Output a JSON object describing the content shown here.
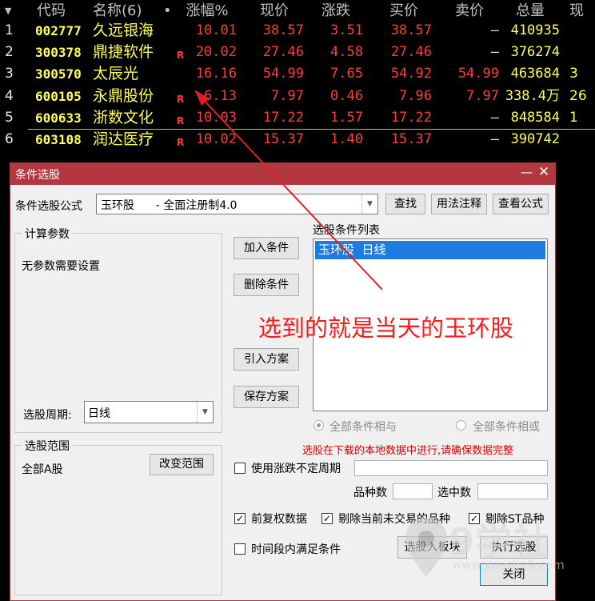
{
  "table": {
    "headers": {
      "sort": "▼",
      "code": "代码",
      "name": "名称(6)",
      "dot": "•",
      "pct": "涨幅%",
      "price": "现价",
      "chg": "涨跌",
      "bid": "买价",
      "ask": "卖价",
      "vol": "总量",
      "extra": "现"
    },
    "rows": [
      {
        "idx": "1",
        "code": "002777",
        "name": "久远银海",
        "r": "",
        "pct": "10.01",
        "price": "38.57",
        "chg": "3.51",
        "bid": "38.57",
        "ask": "—",
        "vol": "410935",
        "extra": ""
      },
      {
        "idx": "2",
        "code": "300378",
        "name": "鼎捷软件",
        "r": "R",
        "pct": "20.02",
        "price": "27.46",
        "chg": "4.58",
        "bid": "27.46",
        "ask": "—",
        "vol": "376274",
        "extra": ""
      },
      {
        "idx": "3",
        "code": "300570",
        "name": "太辰光",
        "r": "",
        "pct": "16.16",
        "price": "54.99",
        "chg": "7.65",
        "bid": "54.92",
        "ask": "54.99",
        "vol": "463684",
        "extra": "3"
      },
      {
        "idx": "4",
        "code": "600105",
        "name": "永鼎股份",
        "r": "R",
        "pct": "6.13",
        "price": "7.97",
        "chg": "0.46",
        "bid": "7.96",
        "ask": "7.97",
        "vol": "338.4万",
        "extra": "26"
      },
      {
        "idx": "5",
        "code": "600633",
        "name": "浙数文化",
        "r": "R",
        "pct": "10.03",
        "price": "17.22",
        "chg": "1.57",
        "bid": "17.22",
        "ask": "—",
        "vol": "848584",
        "extra": "1"
      },
      {
        "idx": "6",
        "code": "603108",
        "name": "润达医疗",
        "r": "R",
        "pct": "10.02",
        "price": "15.37",
        "chg": "1.40",
        "bid": "15.37",
        "ask": "—",
        "vol": "390742",
        "extra": ""
      }
    ]
  },
  "dialog": {
    "title": "条件选股",
    "min_glyph": "—",
    "close_glyph": "✕",
    "formula_label": "条件选股公式",
    "formula_value": "玉环股      - 全面注册制4.0",
    "buttons": {
      "find": "查找",
      "usage": "用法注释",
      "view": "查看公式",
      "add": "加入条件",
      "delete": "删除条件",
      "import": "引入方案",
      "save": "保存方案",
      "change_range": "改变范围",
      "to_block": "选股入板块",
      "execute": "执行选股",
      "close": "关闭"
    },
    "params_group": "计算参数",
    "no_params": "无参数需要设置",
    "period_label": "选股周期:",
    "period_value": "日线",
    "range_group": "选股范围",
    "range_value": "全部A股",
    "cond_list_label": "选股条件列表",
    "cond_items": [
      "玉环股  日线"
    ],
    "radio_and": "全部条件相与",
    "radio_or": "全部条件相或",
    "warning": "选股在下载的本地数据中进行,请确保数据完整",
    "uncertain_period": "使用涨跌不定周期",
    "count_label": "品种数",
    "selected_label": "选中数",
    "checks": {
      "pre_adjust": "前复权数据",
      "exclude_untraded": "剔除当前未交易的品种",
      "exclude_st": "剔除ST品种",
      "time_period": "时间段内满足条件"
    },
    "check_states": {
      "uncertain_period": false,
      "pre_adjust": true,
      "exclude_untraded": true,
      "exclude_st": true,
      "time_period": false
    }
  },
  "annotation": "选到的就是当天的玉环股",
  "watermark": {
    "brand": "9学社",
    "url": "www.xueshe9.com"
  },
  "colors": {
    "titlebar": "#b2373e",
    "selection": "#1e7be0",
    "red_text": "#ff3c3c",
    "yellow_text": "#ffff55"
  }
}
